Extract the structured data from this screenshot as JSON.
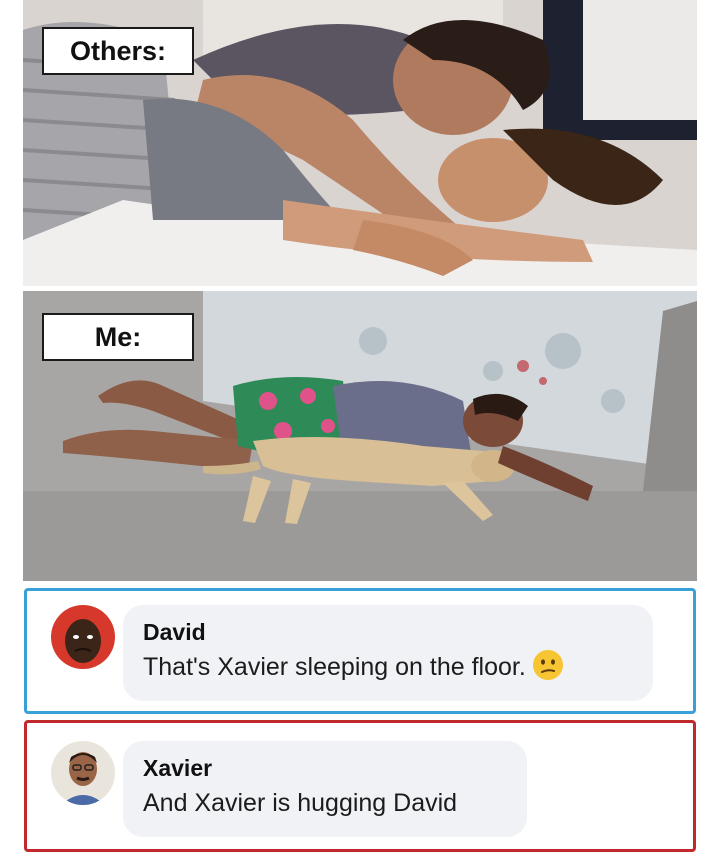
{
  "meme": {
    "top_caption": "Others:",
    "bottom_caption": "Me:"
  },
  "comments": [
    {
      "author": "David",
      "text": "That's Xavier sleeping on the floor.",
      "emoji": "confused-face",
      "border_color": "#3aa0d8"
    },
    {
      "author": "Xavier",
      "text": "And Xavier is hugging David",
      "border_color": "#c0282d"
    }
  ]
}
